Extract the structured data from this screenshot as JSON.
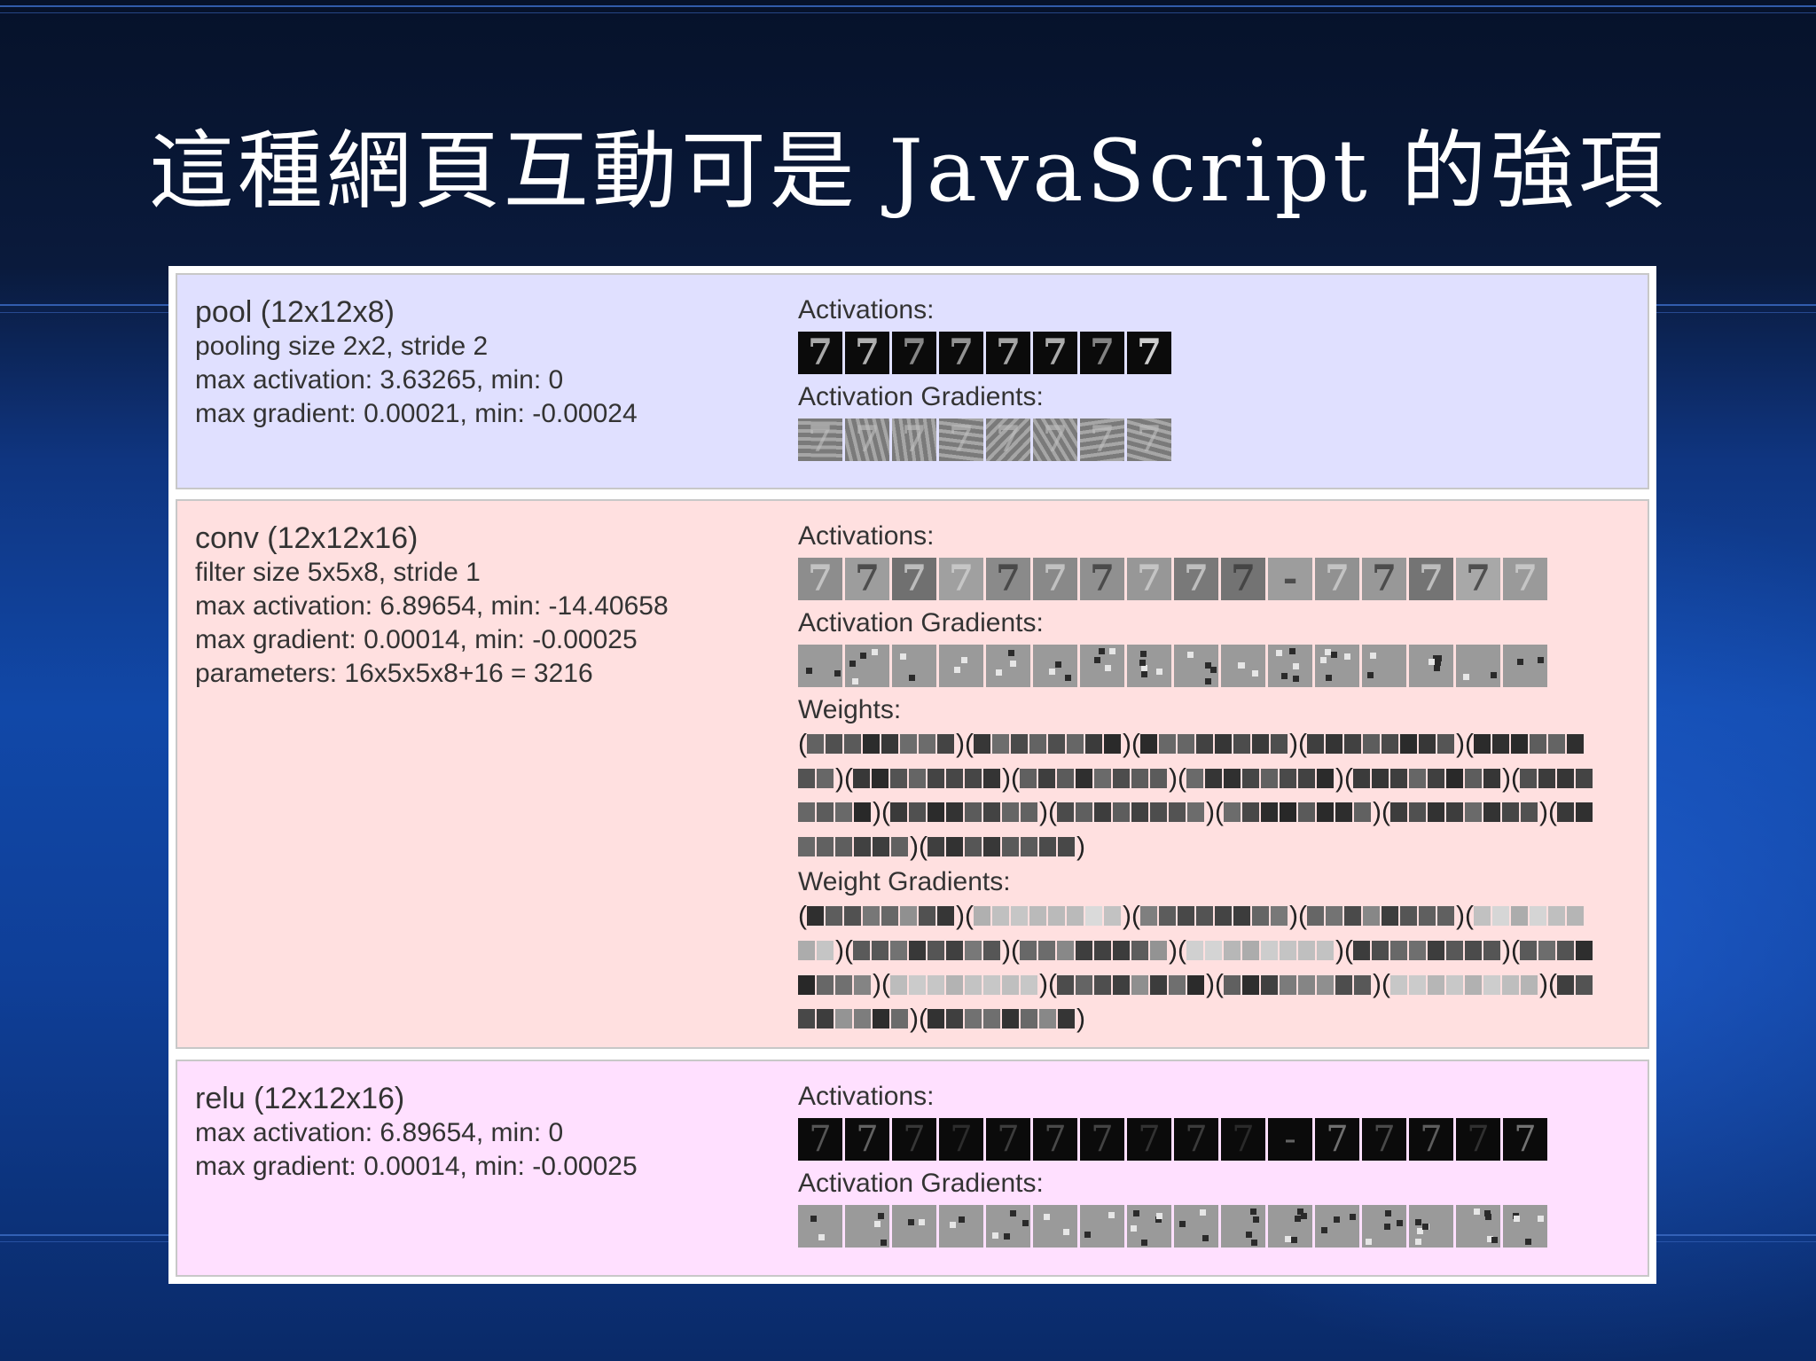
{
  "slide": {
    "title": "這種網頁互動可是 JavaScript 的強項"
  },
  "layers": {
    "pool": {
      "name": "pool (12x12x8)",
      "lines": [
        "pooling size 2x2, stride 2",
        "max activation: 3.63265, min: 0",
        "max gradient: 0.00021, min: -0.00024"
      ],
      "activations_label": "Activations:",
      "activation_gradients_label": "Activation Gradients:",
      "activation_count": 8
    },
    "conv": {
      "name": "conv (12x12x16)",
      "lines": [
        "filter size 5x5x8, stride 1",
        "max activation: 6.89654, min: -14.40658",
        "max gradient: 0.00014, min: -0.00025",
        "parameters: 16x5x5x8+16 = 3216"
      ],
      "activations_label": "Activations:",
      "activation_gradients_label": "Activation Gradients:",
      "weights_label": "Weights:",
      "weight_gradients_label": "Weight Gradients:",
      "activation_count": 16,
      "filter_count": 16
    },
    "relu": {
      "name": "relu (12x12x16)",
      "lines": [
        "max activation: 6.89654, min: 0",
        "max gradient: 0.00014, min: -0.00025"
      ],
      "activations_label": "Activations:",
      "activation_gradients_label": "Activation Gradients:",
      "activation_count": 16
    }
  },
  "colors": {
    "pool_bg": "#e0e0ff",
    "conv_bg": "#ffe0e0",
    "relu_bg": "#ffe0ff"
  }
}
